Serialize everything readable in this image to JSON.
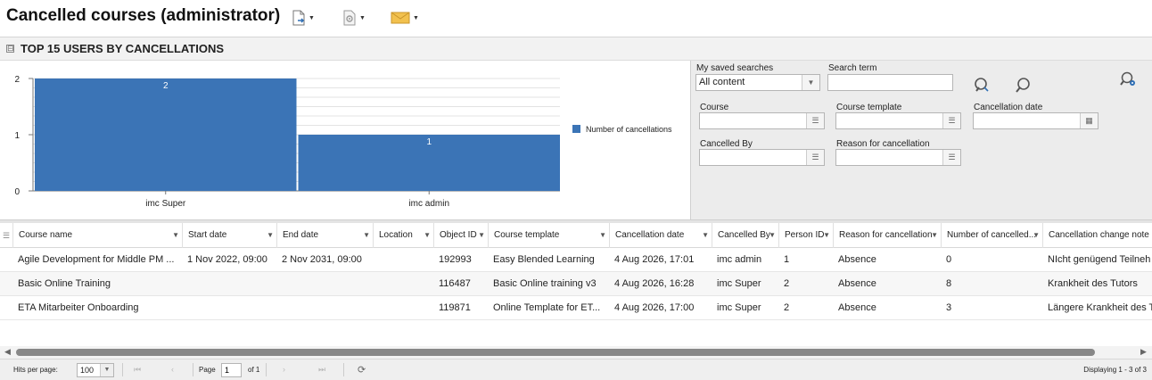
{
  "header": {
    "title": "Cancelled courses (administrator)",
    "icons": [
      "export-document-icon",
      "settings-document-icon",
      "email-icon"
    ]
  },
  "section": {
    "title": "TOP 15 USERS BY CANCELLATIONS",
    "toggle": "⊟"
  },
  "chart_data": {
    "type": "bar",
    "categories": [
      "imc Super",
      "imc admin"
    ],
    "series": [
      {
        "name": "Number of cancellations",
        "values": [
          2,
          1
        ]
      }
    ],
    "ylim": [
      0,
      2
    ],
    "yticks": [
      "0",
      "1",
      "2"
    ],
    "data_labels": [
      "2",
      "1"
    ],
    "legend_position": "right",
    "grid": true,
    "color": "#3b74b6"
  },
  "filters": {
    "saved_searches_label": "My saved searches",
    "saved_searches_value": "All content",
    "search_term_label": "Search term",
    "search_term_value": "",
    "course_label": "Course",
    "course_template_label": "Course template",
    "cancellation_date_label": "Cancellation date",
    "cancelled_by_label": "Cancelled By",
    "reason_label": "Reason for cancellation"
  },
  "table": {
    "columns": [
      "Course name",
      "Start date",
      "End date",
      "Location",
      "Object ID",
      "Course template",
      "Cancellation date",
      "Cancelled By",
      "Person ID",
      "Reason for cancellation",
      "Number of cancelled...",
      "Cancellation change note"
    ],
    "rows": [
      [
        "Agile Development for Middle PM ...",
        "1 Nov 2022, 09:00",
        "2 Nov 2031, 09:00",
        "",
        "192993",
        "Easy Blended Learning",
        "4 Aug 2026, 17:01",
        "imc admin",
        "1",
        "Absence",
        "0",
        "NIcht genügend Teilneh"
      ],
      [
        "Basic Online Training",
        "",
        "",
        "",
        "116487",
        "Basic Online training v3",
        "4 Aug 2026, 16:28",
        "imc Super",
        "2",
        "Absence",
        "8",
        "Krankheit des Tutors"
      ],
      [
        "ETA Mitarbeiter Onboarding",
        "",
        "",
        "",
        "119871",
        "Online Template for ET...",
        "4 Aug 2026, 17:00",
        "imc Super",
        "2",
        "Absence",
        "3",
        "Längere Krankheit des T"
      ]
    ]
  },
  "pager": {
    "hits_label": "Hits per page:",
    "hits_value": "100",
    "page_label": "Page",
    "page_value": "1",
    "of_label": "of 1",
    "displaying": "Displaying 1 - 3 of 3"
  }
}
